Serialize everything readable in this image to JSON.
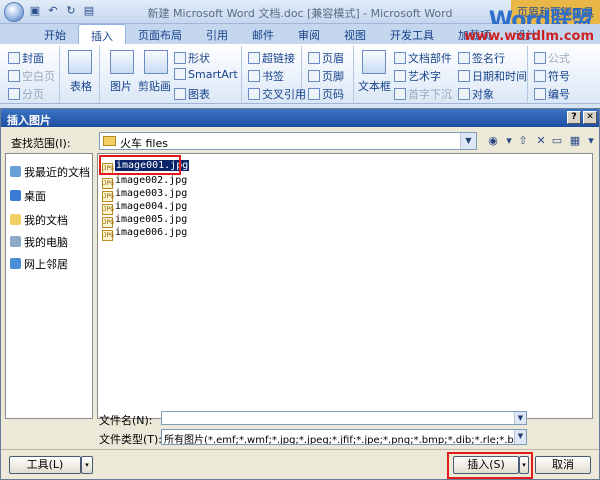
{
  "window": {
    "title": "新建 Microsoft Word 文档.doc [兼容模式] - Microsoft Word",
    "right_context_tab": "页眉和页脚工具",
    "watermark_logo": "Word联盟",
    "watermark_url": "www.wordlm.com"
  },
  "ribbon": {
    "tabs": [
      {
        "label": "开始"
      },
      {
        "label": "插入",
        "active": true
      },
      {
        "label": "页面布局"
      },
      {
        "label": "引用"
      },
      {
        "label": "邮件"
      },
      {
        "label": "审阅"
      },
      {
        "label": "视图"
      },
      {
        "label": "开发工具"
      },
      {
        "label": "加载项"
      },
      {
        "label": "设计"
      }
    ],
    "pages_group": {
      "cover": "封面",
      "blank": "空白页",
      "break": "分页"
    },
    "table": "表格",
    "illustrations": {
      "picture": "图片",
      "clipart": "剪贴画",
      "shapes": "形状",
      "smartart": "SmartArt",
      "chart": "图表"
    },
    "links": {
      "hyperlink": "超链接",
      "bookmark": "书签",
      "crossref": "交叉引用"
    },
    "header_footer": {
      "header": "页眉",
      "footer": "页脚",
      "page_number": "页码"
    },
    "text": {
      "textbox": "文本框",
      "parts": "文档部件",
      "wordart": "艺术字",
      "dropcap": "首字下沉",
      "signature": "签名行",
      "datetime": "日期和时间",
      "object": "对象"
    },
    "symbols": {
      "equation": "公式",
      "symbol": "符号",
      "number": "编号"
    }
  },
  "dialog": {
    "title": "插入图片",
    "lookin_label": "查找范围(I):",
    "lookin_value": "火车 files",
    "places": [
      {
        "label": "我最近的文档"
      },
      {
        "label": "桌面"
      },
      {
        "label": "我的文档"
      },
      {
        "label": "我的电脑"
      },
      {
        "label": "网上邻居"
      }
    ],
    "files": [
      {
        "name": "image001.jpg",
        "selected": true
      },
      {
        "name": "image002.jpg"
      },
      {
        "name": "image003.jpg"
      },
      {
        "name": "image004.jpg"
      },
      {
        "name": "image005.jpg"
      },
      {
        "name": "image006.jpg"
      }
    ],
    "filename_label": "文件名(N):",
    "filename_value": "",
    "filetype_label": "文件类型(T):",
    "filetype_value": "所有图片(*.emf;*.wmf;*.jpg;*.jpeg;*.jfif;*.jpe;*.png;*.bmp;*.dib;*.rle;*.bmz",
    "tools_button": "工具(L)",
    "insert_button": "插入(S)",
    "cancel_button": "取消",
    "help_glyph": "?",
    "close_glyph": "✕"
  }
}
